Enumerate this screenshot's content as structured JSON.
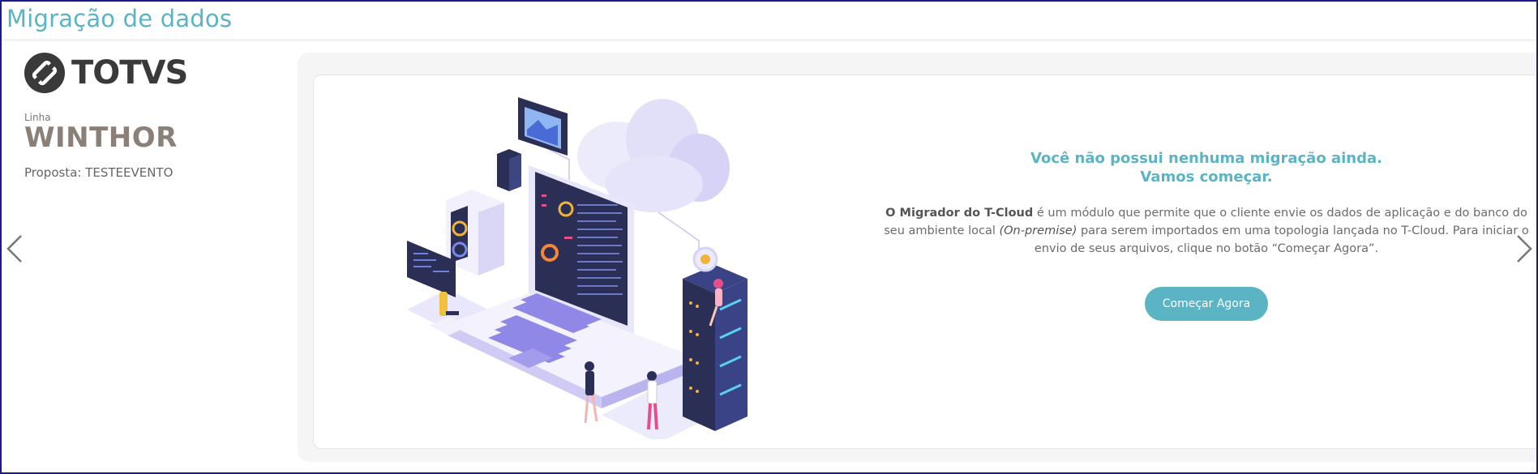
{
  "header": {
    "title": "Migração de dados"
  },
  "sidebar": {
    "logo_text": "TOTVS",
    "line_label": "Linha",
    "product_name": "WINTHOR",
    "proposal": "Proposta: TESTEEVENTO"
  },
  "main": {
    "headline_line1": "Você não possui nenhuma migração ainda.",
    "headline_line2": "Vamos começar.",
    "description": {
      "strong": "O Migrador do T-Cloud",
      "part1": " é um módulo que permite que o cliente envie os dados de aplicação e do banco do seu ambiente local ",
      "italic": "(On-premise)",
      "part2": " para serem importados em uma topologia lançada no T-Cloud. Para iniciar o envio de seus arquivos, clique no botão “Começar Agora”."
    },
    "cta_label": "Começar Agora"
  },
  "icons": {
    "prev": "chevron-left-icon",
    "next": "chevron-right-icon",
    "logo": "totvs-logo-icon"
  },
  "colors": {
    "accent": "#5ab4c4",
    "illustration_dark": "#2b2f55",
    "illustration_lavender": "#bdb8ef"
  }
}
